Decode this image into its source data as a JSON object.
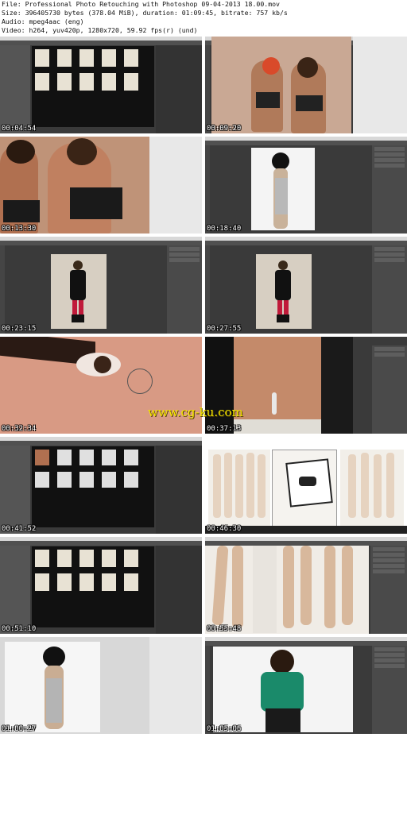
{
  "file_info": {
    "line1": "File: Professional Photo Retouching with Photoshop 09-04-2013 18.00.mov",
    "line2": "Size: 396405730 bytes (378.04 MiB), duration: 01:09:45, bitrate: 757 kb/s",
    "line3": "Audio: mpeg4aac (eng)",
    "line4": "Video: h264, yuv420p, 1280x720, 59.92 fps(r) (und)"
  },
  "watermark": "www.cg-ku.com",
  "thumbnails": [
    {
      "timestamp": "00:04:54",
      "scene": "bridge-browser"
    },
    {
      "timestamp": "00:09:20",
      "scene": "two-women-redhat"
    },
    {
      "timestamp": "00:13:30",
      "scene": "two-women-closeup"
    },
    {
      "timestamp": "00:18:40",
      "scene": "woman-white-bg"
    },
    {
      "timestamp": "00:23:15",
      "scene": "woman-black-coat"
    },
    {
      "timestamp": "00:27:55",
      "scene": "woman-black-coat-2"
    },
    {
      "timestamp": "00:32:34",
      "scene": "eye-closeup"
    },
    {
      "timestamp": "00:37:13",
      "scene": "belly-closeup"
    },
    {
      "timestamp": "00:41:52",
      "scene": "bridge-browser-2"
    },
    {
      "timestamp": "00:46:30",
      "scene": "group-collage"
    },
    {
      "timestamp": "00:51:10",
      "scene": "bridge-browser-3"
    },
    {
      "timestamp": "00:55:48",
      "scene": "legs-white"
    },
    {
      "timestamp": "01:00:27",
      "scene": "woman-white-bg-2"
    },
    {
      "timestamp": "01:05:06",
      "scene": "woman-green-top"
    }
  ],
  "colors": {
    "ps_dark": "#3a3a3a",
    "ps_panel": "#4a4a4a",
    "timestamp": "#ffffff",
    "watermark": "#f6e600"
  }
}
